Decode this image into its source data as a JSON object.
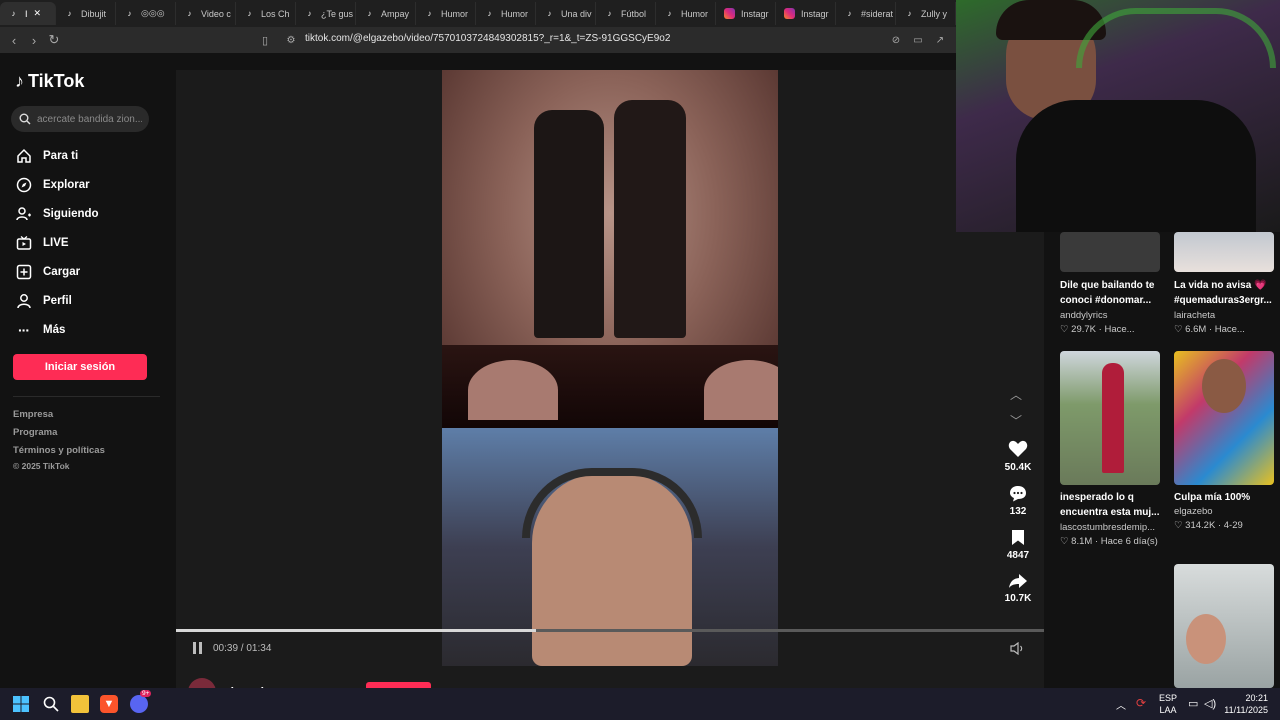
{
  "browser": {
    "tabs": [
      {
        "label": "I",
        "icon": "tiktok-icon",
        "active": true
      },
      {
        "label": "Dibujit",
        "icon": "tiktok-icon"
      },
      {
        "label": "◎◎◎",
        "icon": "tiktok-icon"
      },
      {
        "label": "Video c",
        "icon": "tiktok-icon"
      },
      {
        "label": "Los Ch",
        "icon": "tiktok-icon"
      },
      {
        "label": "¿Te gus",
        "icon": "tiktok-icon"
      },
      {
        "label": "Ampay",
        "icon": "tiktok-icon"
      },
      {
        "label": "Humor",
        "icon": "tiktok-icon"
      },
      {
        "label": "Humor",
        "icon": "tiktok-icon"
      },
      {
        "label": "Una div",
        "icon": "tiktok-icon"
      },
      {
        "label": "Fútbol",
        "icon": "tiktok-icon"
      },
      {
        "label": "Humor",
        "icon": "tiktok-icon"
      },
      {
        "label": "Instagr",
        "icon": "instagram-icon"
      },
      {
        "label": "Instagr",
        "icon": "instagram-icon"
      },
      {
        "label": "#siderat",
        "icon": "tiktok-icon"
      },
      {
        "label": "Zully y",
        "icon": "tiktok-icon"
      }
    ],
    "url": "tiktok.com/@elgazebo/video/7570103724849302815?_r=1&_t=ZS-91GGSCyE9o2"
  },
  "sidebar": {
    "logo": "TikTok",
    "search_placeholder": "acercate bandida zion...",
    "nav": [
      {
        "label": "Para ti",
        "icon": "home-icon"
      },
      {
        "label": "Explorar",
        "icon": "compass-icon"
      },
      {
        "label": "Siguiendo",
        "icon": "following-icon"
      },
      {
        "label": "LIVE",
        "icon": "live-icon"
      },
      {
        "label": "Cargar",
        "icon": "upload-icon"
      },
      {
        "label": "Perfil",
        "icon": "profile-icon"
      },
      {
        "label": "Más",
        "icon": "more-icon"
      }
    ],
    "login_button": "Iniciar sesión",
    "footer": [
      "Empresa",
      "Programa",
      "Términos y políticas",
      "© 2025 TikTok"
    ]
  },
  "player": {
    "time": "00:39 / 01:34",
    "progress": 0.415,
    "likes": "50.4K",
    "comments": "132",
    "saves": "4847",
    "shares": "10.7K",
    "author": "elgazebo"
  },
  "recommendations": [
    {
      "title": "Dile que bailando te conoci #donomar...",
      "user": "anddylyrics",
      "views": "29.7K",
      "time": "Hace..."
    },
    {
      "title": "La vida no avisa 💗 #quemaduras3ergr...",
      "user": "lairacheta",
      "views": "6.6M",
      "time": "Hace..."
    },
    {
      "title": "inesperado lo q encuentra esta muj...",
      "user": "lascostumbresdemip...",
      "views": "8.1M",
      "time": "Hace 6 día(s)"
    },
    {
      "title": "Culpa mía 100%",
      "user": "elgazebo",
      "views": "314.2K",
      "time": "4-29"
    }
  ],
  "taskbar": {
    "lang_top": "ESP",
    "lang_bottom": "LAA",
    "time": "20:21",
    "date": "11/11/2025",
    "discord_badge": "9+"
  }
}
